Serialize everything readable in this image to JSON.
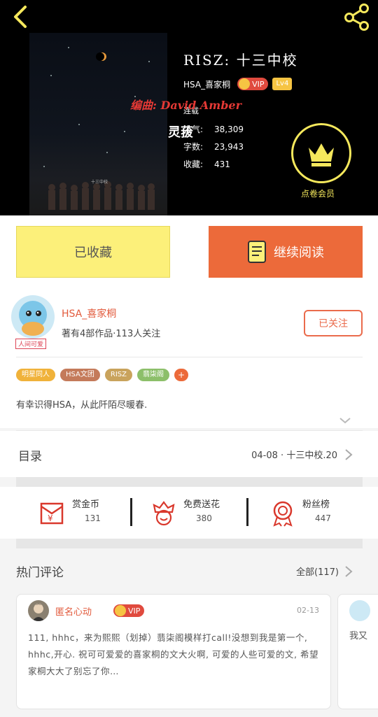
{
  "hero": {
    "book_title": "RISZ: 十三中校",
    "author_name": "HSA_喜家桐",
    "vip_label": "VIP",
    "level_label": "Lv4",
    "editor_text": "编曲: David Amber",
    "overlay_word": "灵菝",
    "status_tag": "连载",
    "stats": [
      {
        "label": "人气:",
        "value": "38,309"
      },
      {
        "label": "字数:",
        "value": "23,943"
      },
      {
        "label": "收藏:",
        "value": "431"
      }
    ],
    "vip_member_label": "点卷会员",
    "cover_caption": "十三中校"
  },
  "actions": {
    "collected_label": "已收藏",
    "continue_label": "继续阅读"
  },
  "author_card": {
    "name": "HSA_喜家桐",
    "subtitle": "著有4部作品·113人关注",
    "avatar_tag": "人间可爱",
    "follow_label": "已关注",
    "tags": [
      {
        "label": "明星同人",
        "color": "#f0b23a"
      },
      {
        "label": "HSA文团",
        "color": "#c47a5a"
      },
      {
        "label": "RISZ",
        "color": "#c9a35c"
      },
      {
        "label": "翡柒阁",
        "color": "#8cbf6a"
      }
    ],
    "tag_more": "+",
    "bio": "有幸识得HSA，从此阡陌尽暖春."
  },
  "toc": {
    "label": "目录",
    "latest": "04-08 · 十三中校.20"
  },
  "rewards": [
    {
      "title": "赏金币",
      "count": "131",
      "icon": "red-envelope-icon"
    },
    {
      "title": "免费送花",
      "count": "380",
      "icon": "flower-icon"
    },
    {
      "title": "粉丝榜",
      "count": "447",
      "icon": "medal-icon"
    }
  ],
  "comments": {
    "title": "热门评论",
    "all_label": "全部(117)",
    "items": [
      {
        "user": "匿名心动",
        "vip_label": "VIP",
        "date": "02-13",
        "text": "111, hhhc，来为熙熙（划掉）翡柒阁模样打call!没想到我是第一个, hhhc,开心. 祝可可爱爱的喜家桐的文大火啊, 可爱的人些可爱的文, 希望家桐大大了别忘了你…"
      }
    ],
    "second_preview": "我又"
  }
}
